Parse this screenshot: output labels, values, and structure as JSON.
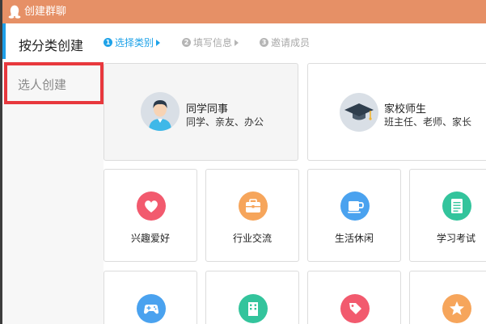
{
  "window": {
    "title": "创建群聊"
  },
  "sidebar": {
    "items": [
      {
        "label": "按分类创建"
      },
      {
        "label": "选人创建"
      }
    ]
  },
  "steps": [
    {
      "num": "1",
      "label": "选择类别"
    },
    {
      "num": "2",
      "label": "填写信息"
    },
    {
      "num": "3",
      "label": "邀请成员"
    }
  ],
  "big_cards": [
    {
      "title": "同学同事",
      "subtitle": "同学、亲友、办公"
    },
    {
      "title": "家校师生",
      "subtitle": "班主任、老师、家长"
    }
  ],
  "categories": [
    {
      "label": "兴趣爱好",
      "color": "#f25a6e",
      "icon": "heart-icon"
    },
    {
      "label": "行业交流",
      "color": "#f6a55b",
      "icon": "briefcase-icon"
    },
    {
      "label": "生活休闲",
      "color": "#4aa2ef",
      "icon": "coffee-cup-icon"
    },
    {
      "label": "学习考试",
      "color": "#33c49c",
      "icon": "document-icon"
    },
    {
      "label": "",
      "color": "#4aa2ef",
      "icon": "gamepad-icon"
    },
    {
      "label": "",
      "color": "#33c49c",
      "icon": "building-icon"
    },
    {
      "label": "",
      "color": "#f25a6e",
      "icon": "tag-icon"
    },
    {
      "label": "",
      "color": "#f6a55b",
      "icon": "star-icon"
    }
  ],
  "colors": {
    "titlebar": "#e69066",
    "accent": "#1ea2e8",
    "highlight_box": "#e8383d"
  }
}
